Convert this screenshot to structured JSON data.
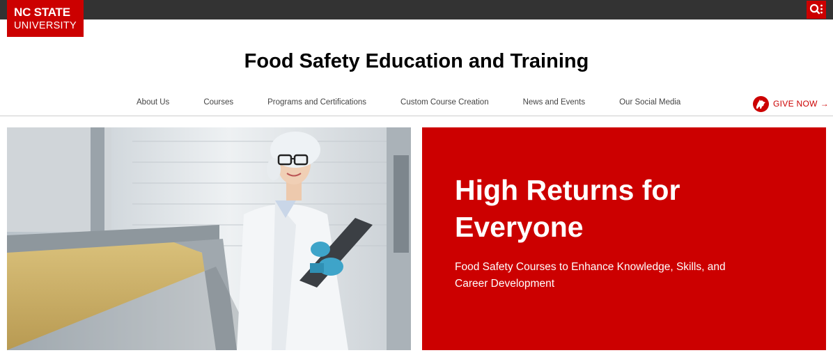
{
  "brand": {
    "line1": "NC STATE",
    "line2": "UNIVERSITY"
  },
  "utility": {
    "icon": "search-menu-icon"
  },
  "site_title": "Food Safety Education and Training",
  "nav": {
    "items": [
      {
        "label": "About Us"
      },
      {
        "label": "Courses"
      },
      {
        "label": "Programs and Certifications"
      },
      {
        "label": "Custom Course Creation"
      },
      {
        "label": "News and Events"
      },
      {
        "label": "Our Social Media"
      }
    ]
  },
  "give": {
    "label": "GIVE NOW",
    "arrow": "→",
    "icon": "wolf-icon"
  },
  "hero": {
    "headline": "High Returns for Everyone",
    "subtext": "Food Safety Courses to Enhance Knowledge, Skills, and Career Development"
  },
  "colors": {
    "brand_red": "#cc0000",
    "topbar": "#333333",
    "nav_text": "#444444"
  }
}
